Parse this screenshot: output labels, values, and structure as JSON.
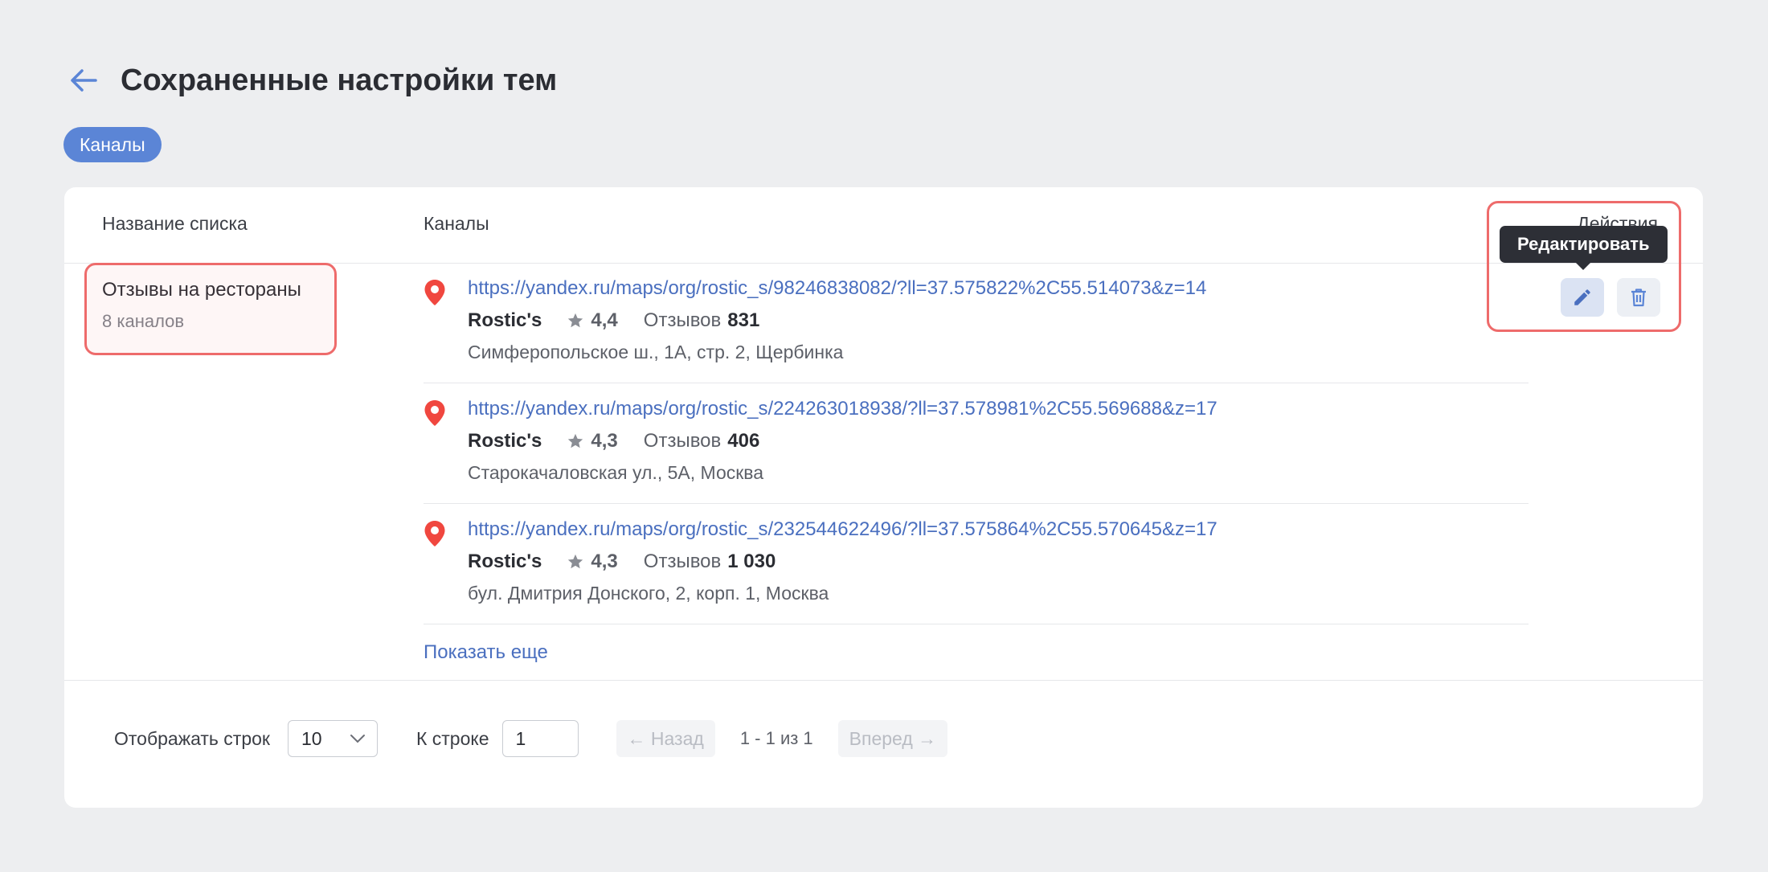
{
  "header": {
    "title": "Сохраненные настройки тем"
  },
  "tag": {
    "label": "Каналы"
  },
  "table": {
    "col_name": "Название списка",
    "col_channels": "Каналы",
    "col_actions": "Действия"
  },
  "row": {
    "title": "Отзывы на рестораны",
    "subtitle": "8 каналов"
  },
  "channels": [
    {
      "url": "https://yandex.ru/maps/org/rostic_s/98246838082/?ll=37.575822%2C55.514073&z=14",
      "name": "Rostic's",
      "rating": "4,4",
      "reviews_label": "Отзывов",
      "reviews_count": "831",
      "address": "Симферопольское ш., 1А, стр. 2, Щербинка"
    },
    {
      "url": "https://yandex.ru/maps/org/rostic_s/224263018938/?ll=37.578981%2C55.569688&z=17",
      "name": "Rostic's",
      "rating": "4,3",
      "reviews_label": "Отзывов",
      "reviews_count": "406",
      "address": "Старокачаловская ул., 5А, Москва"
    },
    {
      "url": "https://yandex.ru/maps/org/rostic_s/232544622496/?ll=37.575864%2C55.570645&z=17",
      "name": "Rostic's",
      "rating": "4,3",
      "reviews_label": "Отзывов",
      "reviews_count": "1 030",
      "address": "бул. Дмитрия Донского, 2, корп. 1, Москва"
    }
  ],
  "show_more": "Показать еще",
  "actions": {
    "tooltip": "Редактировать"
  },
  "pagination": {
    "rows_label": "Отображать строк",
    "rows_value": "10",
    "goto_label": "К строке",
    "goto_value": "1",
    "prev": "← Назад",
    "info": "1 - 1 из 1",
    "next": "Вперед →"
  },
  "colors": {
    "accent": "#5b85d6",
    "link": "#4a6fbf",
    "pin": "#f0473f",
    "highlight": "#ee6b6b"
  },
  "icons": [
    "arrow-left-icon",
    "map-pin-icon",
    "star-icon",
    "pencil-icon",
    "trash-icon",
    "chevron-down-icon"
  ]
}
